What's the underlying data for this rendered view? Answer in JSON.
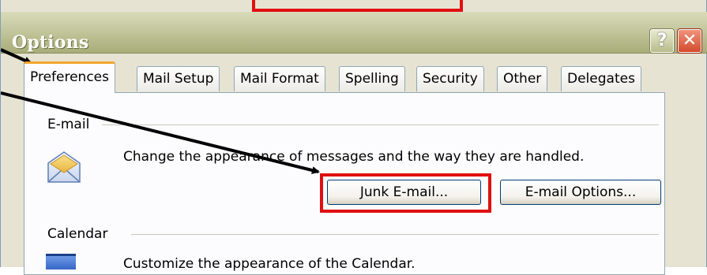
{
  "window": {
    "title": "Options"
  },
  "title_buttons": {
    "help_glyph": "?",
    "close_glyph": "✕"
  },
  "tabs": [
    {
      "label": "Preferences",
      "active": true
    },
    {
      "label": "Mail Setup"
    },
    {
      "label": "Mail Format"
    },
    {
      "label": "Spelling"
    },
    {
      "label": "Security"
    },
    {
      "label": "Other"
    },
    {
      "label": "Delegates"
    }
  ],
  "email_group": {
    "label": "E-mail",
    "description": "Change the appearance of messages and the way they are handled.",
    "icon": "envelope-icon",
    "buttons": {
      "junk": "Junk E-mail...",
      "options": "E-mail Options..."
    }
  },
  "calendar_group": {
    "label": "Calendar",
    "description": "Customize the appearance of the Calendar.",
    "icon": "calendar-icon"
  },
  "annotation_color": "#e01010"
}
